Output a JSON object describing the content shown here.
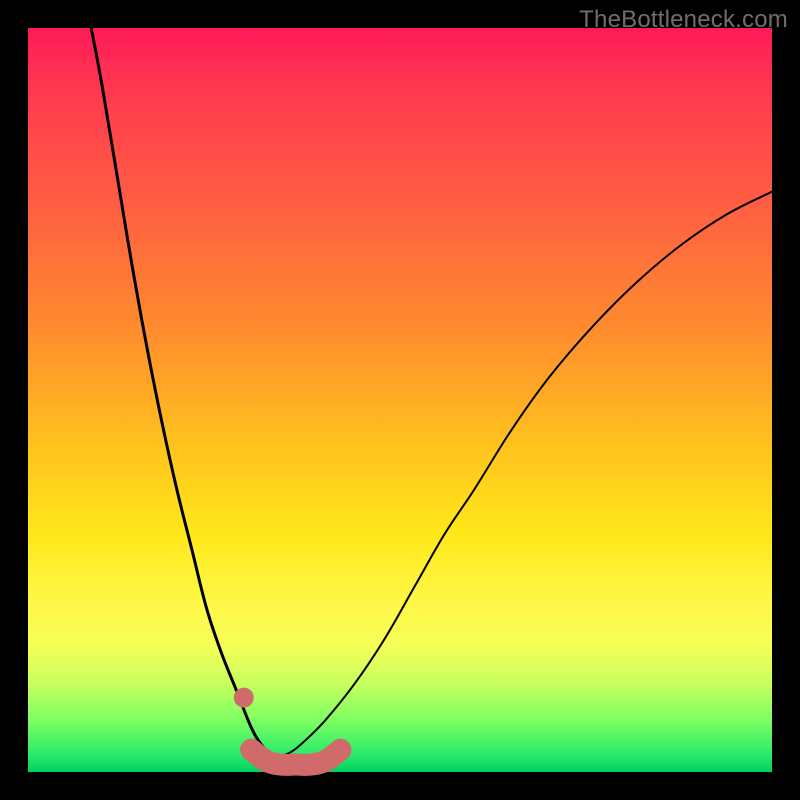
{
  "watermark": "TheBottleneck.com",
  "colors": {
    "frame_bg": "#000000",
    "curve_stroke": "#000000",
    "marker_stroke": "#d16a6a",
    "marker_fill": "#d16a6a"
  },
  "chart_data": {
    "type": "line",
    "title": "",
    "xlabel": "",
    "ylabel": "",
    "xlim": [
      0,
      100
    ],
    "ylim": [
      0,
      100
    ],
    "grid": false,
    "legend": false,
    "series": [
      {
        "name": "left-branch",
        "x": [
          8.5,
          10,
          12,
          14,
          16,
          18,
          20,
          22,
          24,
          26,
          28,
          30,
          31.5,
          33
        ],
        "y": [
          100,
          92,
          80,
          68,
          57,
          47,
          38,
          30,
          22,
          16,
          11,
          6,
          3.5,
          2
        ]
      },
      {
        "name": "right-branch",
        "x": [
          33,
          35,
          37,
          40,
          44,
          48,
          52,
          56,
          60,
          65,
          70,
          76,
          82,
          88,
          94,
          100
        ],
        "y": [
          2,
          2.5,
          4,
          7,
          12,
          18,
          25,
          32,
          38,
          46,
          53,
          60,
          66,
          71,
          75,
          78
        ]
      },
      {
        "name": "bottom-floor",
        "x": [
          30,
          32,
          34,
          36,
          38,
          40,
          42
        ],
        "y": [
          3,
          1.5,
          1,
          1,
          1,
          1.5,
          3
        ]
      }
    ],
    "markers": [
      {
        "x": 29,
        "y": 10
      }
    ]
  }
}
